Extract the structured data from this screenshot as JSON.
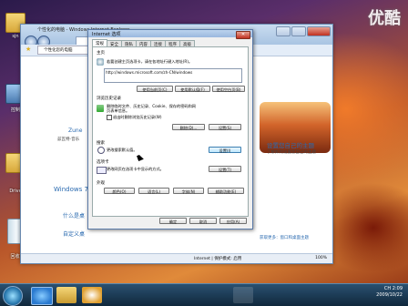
{
  "watermark": "优酷",
  "desktop": {
    "icons": [
      {
        "label": "sjn"
      },
      {
        "label": "控制"
      },
      {
        "label": "Drive"
      }
    ],
    "recycle_label": "回收站",
    "recycle_sub": "幻灯片"
  },
  "ie": {
    "title": "个性化的电脑 - Windows Internet Explorer",
    "tab_label": "个性化您的电脑",
    "zune_label": "Zune",
    "zune_sub": "兹瓦特-音乐",
    "windows7": "Windows 7",
    "what_is": "什么是桌",
    "custom_link": "自定义桌",
    "bottom_link": "获取更多：窗口和桌面主题",
    "promo_title": "设置您自己的主题",
    "promo_sub": "了解如何设置您自己的主题",
    "status_zone": "Internet | 保护模式: 启用",
    "zoom": "100%"
  },
  "dialog": {
    "title": "Internet 选项",
    "close": "✕",
    "tabs": [
      "常规",
      "安全",
      "隐私",
      "内容",
      "连接",
      "程序",
      "高级"
    ],
    "active_tab": "常规",
    "home": {
      "heading": "主页",
      "desc": "若要创建主页选项卡，请在各地址行键入地址(R)。",
      "url": "http://windows.microsoft.com/zh-CN/windows",
      "btn_current": "使用当前页(C)",
      "btn_default": "使用默认值(F)",
      "btn_blank": "使用空白页(B)"
    },
    "history": {
      "heading": "浏览历史记录",
      "desc1": "删除临时文件、历史记录、Cookie、保存的密码和网",
      "desc2": "页表单信息。",
      "check_label": "退出时删除浏览历史记录(W)",
      "btn_delete": "删除(D)...",
      "btn_settings": "设置(S)"
    },
    "search": {
      "heading": "搜索",
      "desc": "更改搜索默认值。",
      "btn_settings": "设置(I)"
    },
    "tabs_section": {
      "heading": "选项卡",
      "desc": "更改网页在选项卡中显示的方式。",
      "btn_settings": "设置(T)"
    },
    "appearance": {
      "heading": "外观",
      "btn_colors": "颜色(O)",
      "btn_languages": "语言(L)",
      "btn_fonts": "字体(N)",
      "btn_accessibility": "辅助功能(E)"
    },
    "btn_ok": "确定",
    "btn_cancel": "取消",
    "btn_apply": "应用(A)"
  },
  "taskbar": {
    "time": "2:09",
    "date": "2009/10/22",
    "lang": "CH"
  }
}
